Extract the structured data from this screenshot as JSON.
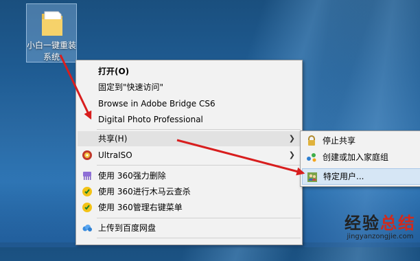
{
  "desktop": {
    "icon_label_line1": "小白一键重装",
    "icon_label_line2": "系统"
  },
  "context_menu": {
    "items": [
      {
        "label": "打开(O)"
      },
      {
        "label": "固定到\"快速访问\""
      },
      {
        "label": "Browse in Adobe Bridge CS6"
      },
      {
        "label": "Digital Photo Professional"
      },
      {
        "label": "共享(H)"
      },
      {
        "label": "UltraISO"
      },
      {
        "label": "使用 360强力删除"
      },
      {
        "label": "使用 360进行木马云查杀"
      },
      {
        "label": "使用 360管理右键菜单"
      },
      {
        "label": "上传到百度网盘"
      }
    ]
  },
  "share_submenu": {
    "items": [
      {
        "label": "停止共享",
        "icon": "lock-icon"
      },
      {
        "label": "创建或加入家庭组",
        "icon": "homegroup-icon"
      },
      {
        "label": "特定用户...",
        "icon": "users-icon"
      }
    ]
  },
  "watermark": {
    "part1": "经验",
    "part2": "总结",
    "url": "jingyanzongjie.com"
  },
  "colors": {
    "annotation_arrow": "#d81e1e",
    "highlight": "#d6e6f5",
    "menu_bg": "#f2f2f2"
  }
}
